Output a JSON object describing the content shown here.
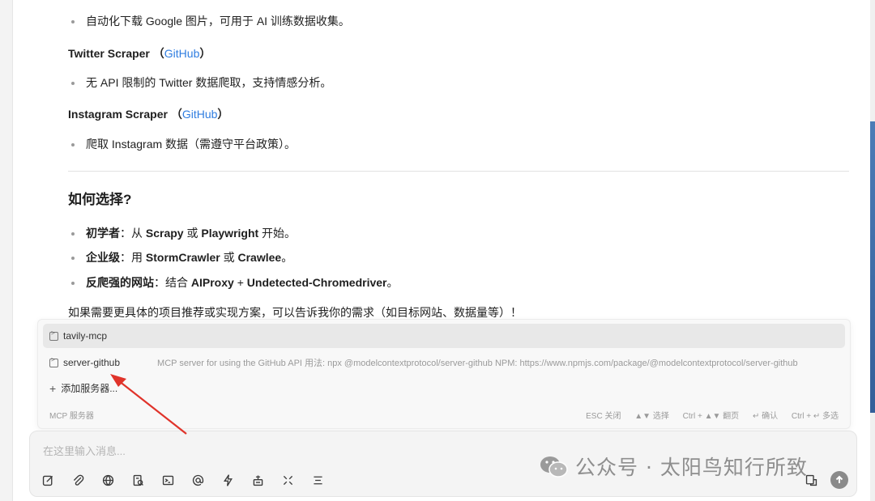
{
  "chat": {
    "bullet_google": "自动化下载 Google 图片，可用于 AI 训练数据收集。",
    "twitter": {
      "title": "Twitter Scraper",
      "open": "（",
      "link": "GitHub",
      "close": "）",
      "bullet": "无 API 限制的 Twitter 数据爬取，支持情感分析。"
    },
    "instagram": {
      "title": "Instagram Scraper",
      "open": "（",
      "link": "GitHub",
      "close": "）",
      "bullet": "爬取 Instagram 数据（需遵守平台政策）。"
    },
    "section_title": "如何选择?",
    "choices": [
      {
        "label": "初学者",
        "sep": "：从 ",
        "a": "Scrapy",
        "mid": " 或 ",
        "b": "Playwright",
        "end": " 开始。"
      },
      {
        "label": "企业级",
        "sep": "：用 ",
        "a": "StormCrawler",
        "mid": " 或 ",
        "b": "Crawlee",
        "end": "。"
      },
      {
        "label": "反爬强的网站",
        "sep": "：结合 ",
        "a": "AIProxy",
        "mid": " + ",
        "b": "Undetected-Chromedriver",
        "end": "。"
      }
    ],
    "closing": "如果需要更具体的项目推荐或实现方案，可以告诉我你的需求（如目标网站、数据量等）！"
  },
  "mcp_popup": {
    "servers": [
      {
        "name": "tavily-mcp",
        "desc": ""
      },
      {
        "name": "server-github",
        "desc": "MCP server for using the GitHub API 用法: npx @modelcontextprotocol/server-github NPM: https://www.npmjs.com/package/@modelcontextprotocol/server-github"
      }
    ],
    "add_label": "添加服务器...",
    "footer_label": "MCP 服务器",
    "hints": [
      "ESC 关闭",
      "▲▼ 选择",
      "Ctrl + ▲▼ 翻页",
      "↵ 确认",
      "Ctrl + ↵ 多选"
    ]
  },
  "input": {
    "placeholder": "在这里输入消息..."
  },
  "toolbar_icons": [
    "edit-icon",
    "attachment-icon",
    "globe-icon",
    "knowledge-icon",
    "terminal-icon",
    "mention-icon",
    "lightning-icon",
    "mcp-server-icon",
    "expand-icon",
    "menu-icon"
  ],
  "watermark": {
    "text": "公众号 · 太阳鸟知行所致"
  },
  "colors": {
    "link": "#2f7de0",
    "arrow": "#e0332a",
    "background": "#ffffff"
  }
}
